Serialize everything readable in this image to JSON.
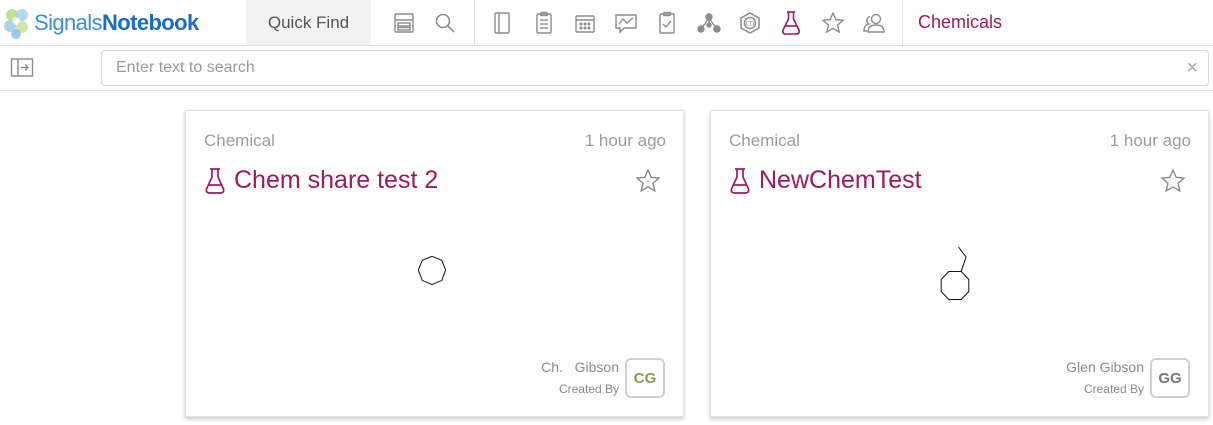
{
  "header": {
    "logo_left": "Signals",
    "logo_right": "Notebook",
    "quick_find": "Quick Find",
    "breadcrumb": "Chemicals",
    "toolbar": [
      {
        "icon": "form-icon"
      },
      {
        "icon": "search-icon"
      },
      {
        "icon": "notebook-icon"
      },
      {
        "icon": "clipboard-icon"
      },
      {
        "icon": "calendar-icon"
      },
      {
        "icon": "chart-chat-icon"
      },
      {
        "icon": "checklist-icon"
      },
      {
        "icon": "network-icon"
      },
      {
        "icon": "cd-hexagon-icon"
      },
      {
        "icon": "flask-icon"
      },
      {
        "icon": "star-icon"
      },
      {
        "icon": "users-icon"
      }
    ]
  },
  "search": {
    "placeholder": "Enter text to search",
    "clear": "×"
  },
  "cards": [
    {
      "kind": "Chemical",
      "time": "1 hour ago",
      "title": "Chem share test 2",
      "creator": "Ch.   Gibson",
      "created_by_label": "Created By",
      "initials": "CG",
      "initials_color": "#8a9a4a"
    },
    {
      "kind": "Chemical",
      "time": "1 hour ago",
      "title": "NewChemTest",
      "creator": "Glen Gibson",
      "created_by_label": "Created By",
      "initials": "GG",
      "initials_color": "#777777"
    }
  ],
  "colors": {
    "accent": "#9b1b62",
    "brand_blue": "#1b6dbf",
    "icon_gray": "#8c8c8c"
  }
}
